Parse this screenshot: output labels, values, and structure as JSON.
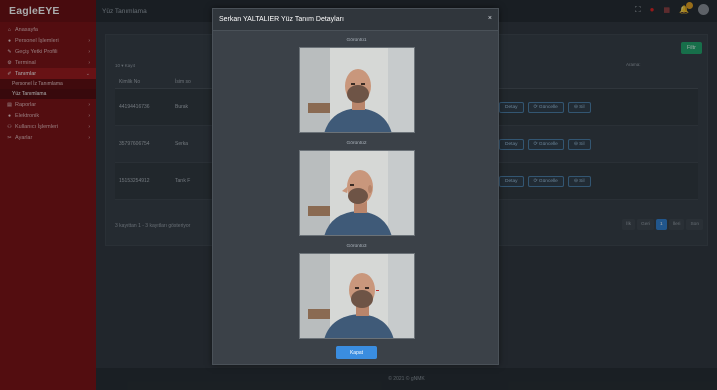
{
  "brand": "EagleEYE",
  "topbar": {
    "title": "Yüz Tanımlama"
  },
  "sidebar": {
    "items": [
      {
        "icon": "home-icon",
        "glyph": "⌂",
        "label": "Anasayfa",
        "chev": ""
      },
      {
        "icon": "users-icon",
        "glyph": "👥",
        "label": "Personel İşlemleri",
        "chev": "›"
      },
      {
        "icon": "key-icon",
        "glyph": "✎",
        "label": "Geçiş Yetki Profili",
        "chev": "›"
      },
      {
        "icon": "gear-icon",
        "glyph": "⚙",
        "label": "Terminal",
        "chev": "›"
      },
      {
        "icon": "pencil-icon",
        "glyph": "✐",
        "label": "Tanımlar",
        "chev": "⌄"
      },
      {
        "icon": "",
        "glyph": "",
        "label": "Personel İz Tanımlama",
        "chev": ""
      },
      {
        "icon": "",
        "glyph": "",
        "label": "Yüz Tanımlama",
        "chev": ""
      },
      {
        "icon": "chart-icon",
        "glyph": "▤",
        "label": "Raporlar",
        "chev": "›"
      },
      {
        "icon": "bolt-icon",
        "glyph": "●",
        "label": "Elektronik",
        "chev": "›"
      },
      {
        "icon": "user-group-icon",
        "glyph": "⚇",
        "label": "Kullanıcı İşlemleri",
        "chev": "›"
      },
      {
        "icon": "wrench-icon",
        "glyph": "✂",
        "label": "Ayarlar",
        "chev": "›"
      }
    ]
  },
  "toolbar": {
    "filter_label": "Filtr",
    "perpage": "10  ▾  Kayıt",
    "search_label": "Arama:"
  },
  "table": {
    "headers": [
      "Kimlik No",
      "İsim so"
    ],
    "rows": [
      {
        "id": "44194416736",
        "name": "Burak"
      },
      {
        "id": "35797606754",
        "name": "Serka"
      },
      {
        "id": "15153254912",
        "name": "Tarık F"
      }
    ],
    "actions": [
      "Detay",
      "⟳ Güncelle",
      "⊖ Sil"
    ]
  },
  "footer_info": "3 kayıttan 1 - 3 kayıtları gösteriyor",
  "pager": [
    "İlk",
    "Geri",
    "1",
    "İleri",
    "Son"
  ],
  "copyright": "© 2021 © gNMK",
  "modal": {
    "title": "Serkan YALTALIER Yüz Tanım Detayları",
    "close_glyph": "×",
    "faces": [
      "Görüntü1",
      "Görüntü2",
      "Görüntü3"
    ],
    "close_button": "Kapat"
  },
  "colors": {
    "sidebar": "#7b0f12",
    "accent": "#3a8de0",
    "filter": "#1fa56b"
  }
}
